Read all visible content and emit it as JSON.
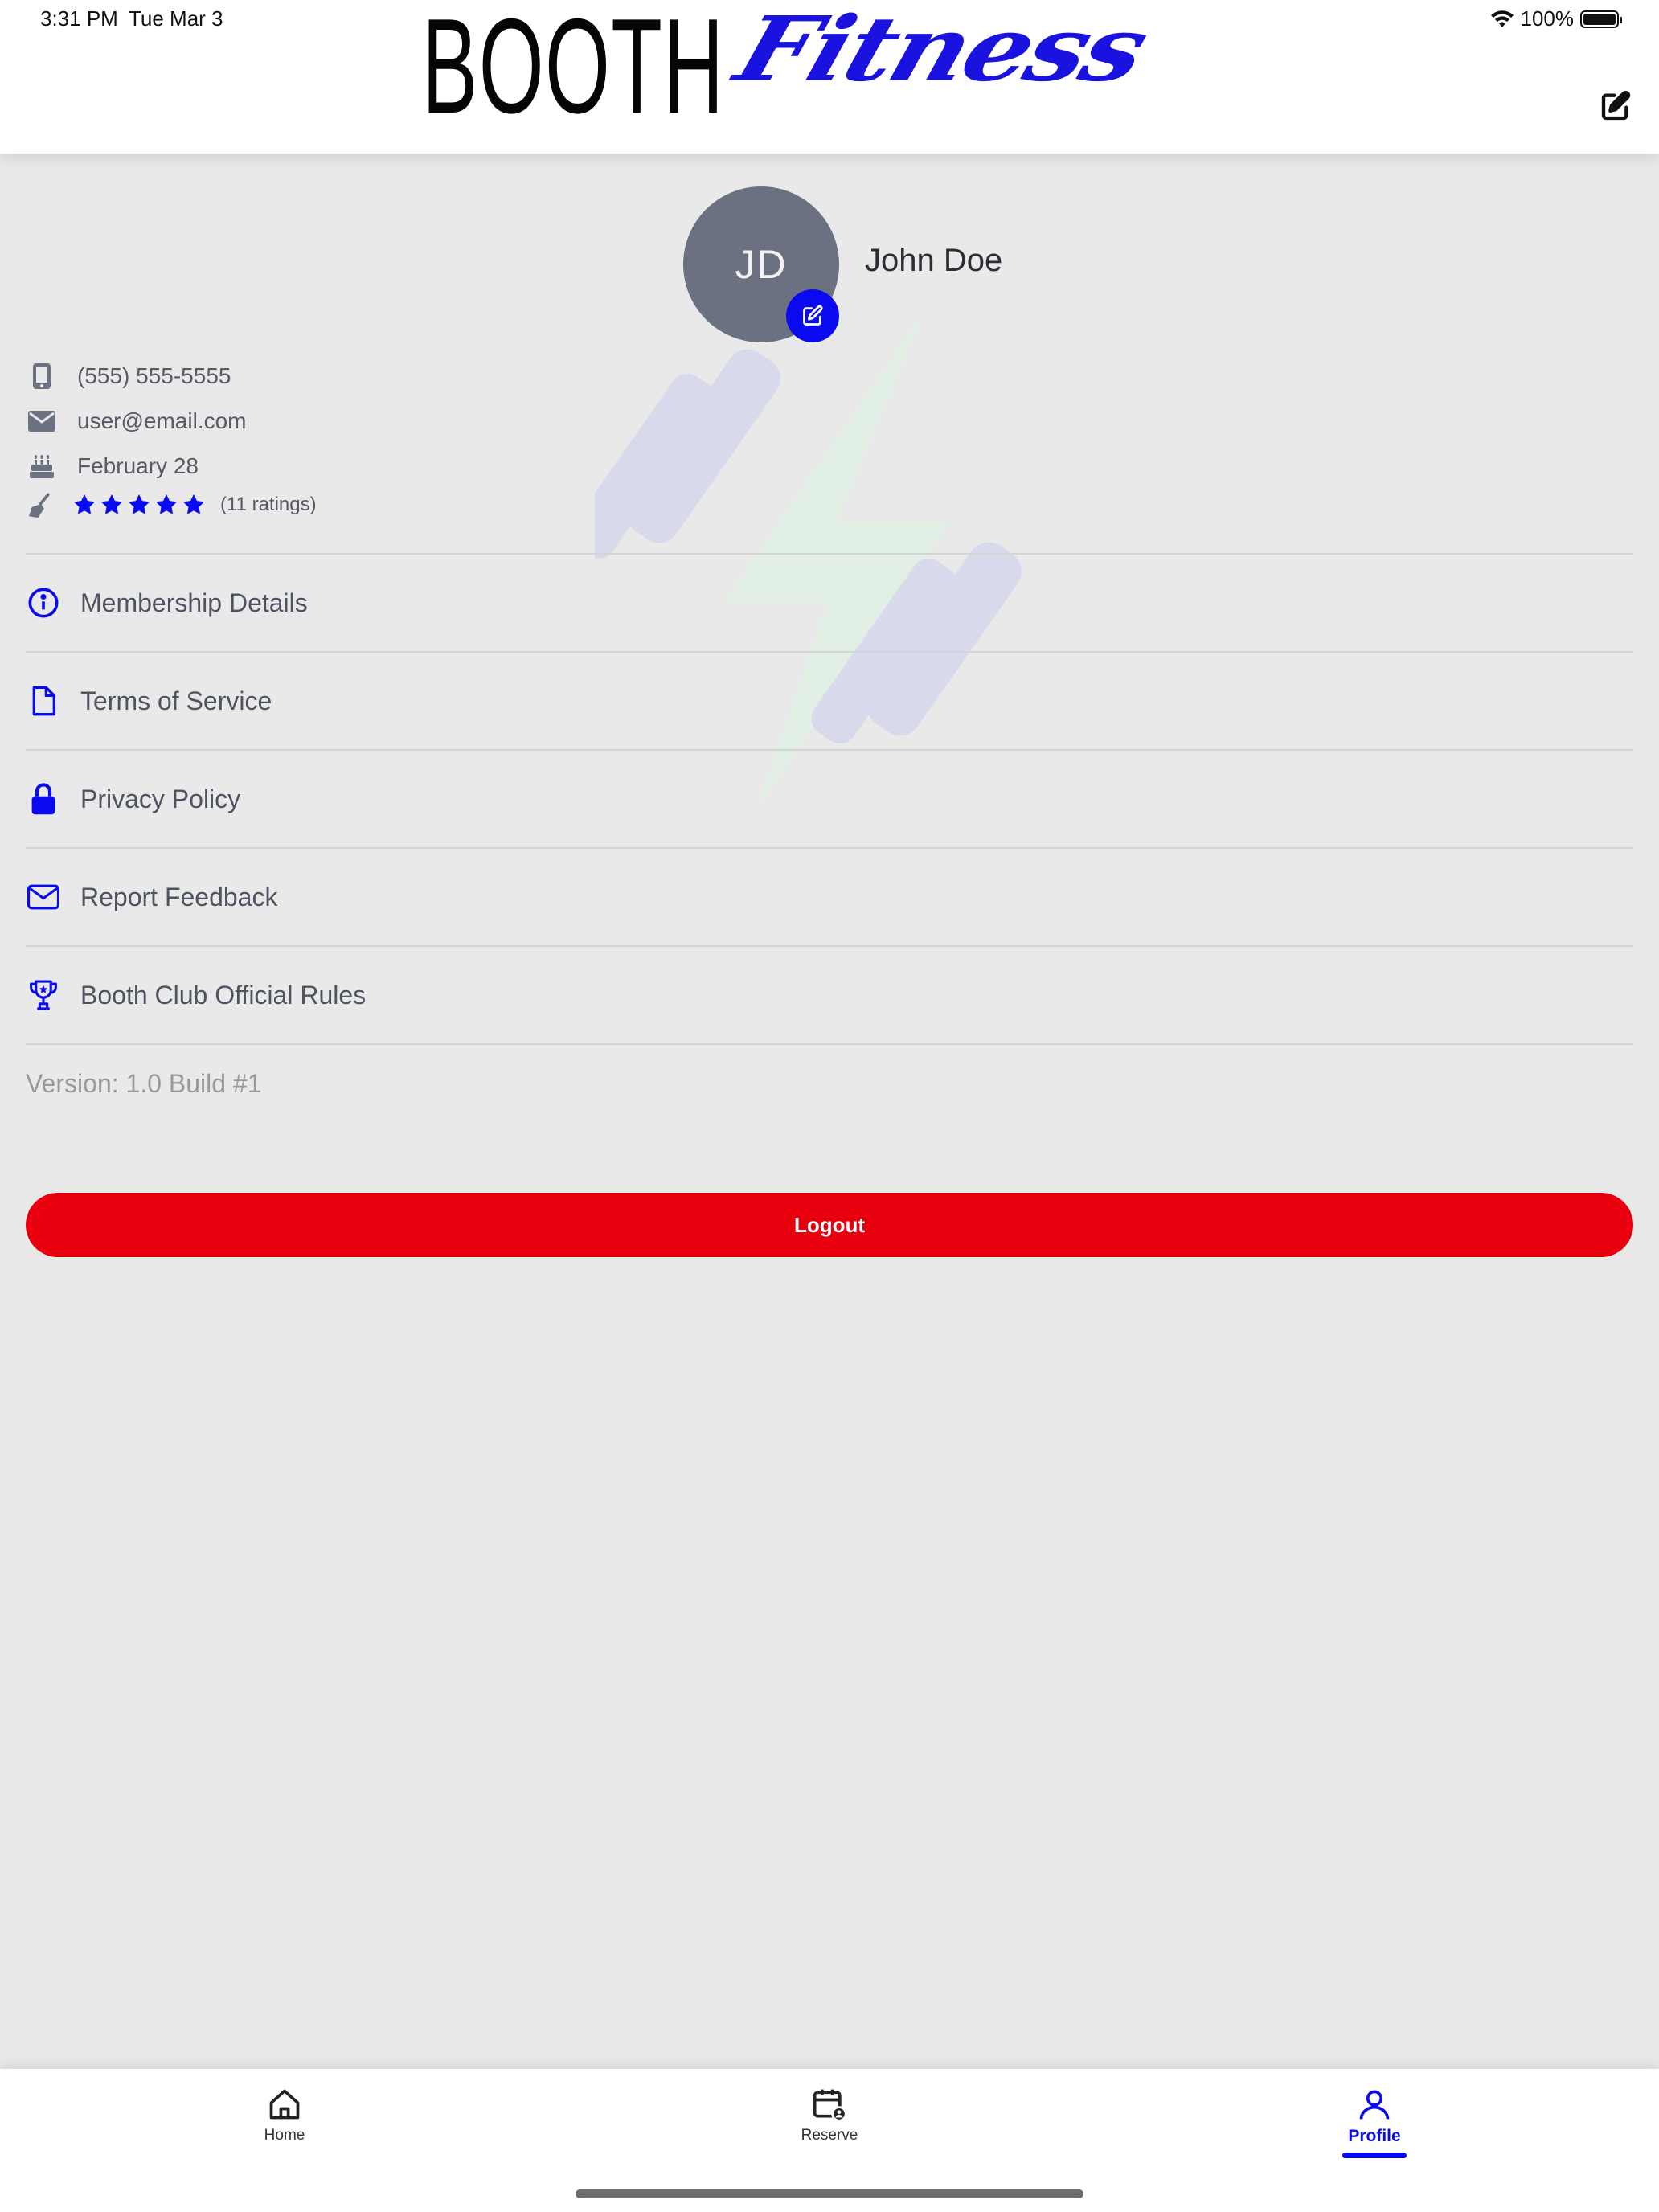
{
  "status_bar": {
    "time": "3:31 PM",
    "date": "Tue Mar 3",
    "battery": "100%",
    "icons": [
      "wifi-icon",
      "battery-icon"
    ]
  },
  "header": {
    "logo_word_1": "BOOTH",
    "logo_word_2": "Fitness",
    "edit_icon": "edit-icon"
  },
  "profile": {
    "initials": "JD",
    "name": "John Doe",
    "phone": "(555) 555-5555",
    "email": "user@email.com",
    "birthday": "February 28",
    "rating_stars": 5,
    "ratings_count": "(11 ratings)"
  },
  "menu": {
    "items": [
      {
        "label": "Membership Details",
        "icon": "info-icon"
      },
      {
        "label": "Terms of Service",
        "icon": "document-icon"
      },
      {
        "label": "Privacy Policy",
        "icon": "lock-icon"
      },
      {
        "label": "Report Feedback",
        "icon": "envelope-icon"
      },
      {
        "label": "Booth Club Official Rules",
        "icon": "trophy-icon"
      }
    ]
  },
  "version": "Version: 1.0 Build #1",
  "logout_label": "Logout",
  "tabbar": {
    "tabs": [
      {
        "label": "Home",
        "icon": "home-icon",
        "active": false
      },
      {
        "label": "Reserve",
        "icon": "calendar-icon",
        "active": false
      },
      {
        "label": "Profile",
        "icon": "person-icon",
        "active": true
      }
    ]
  },
  "colors": {
    "accent_blue": "#0a0af0",
    "logout_red": "#e8000f",
    "avatar_gray": "#6b7180",
    "background": "#e9e9e9"
  }
}
